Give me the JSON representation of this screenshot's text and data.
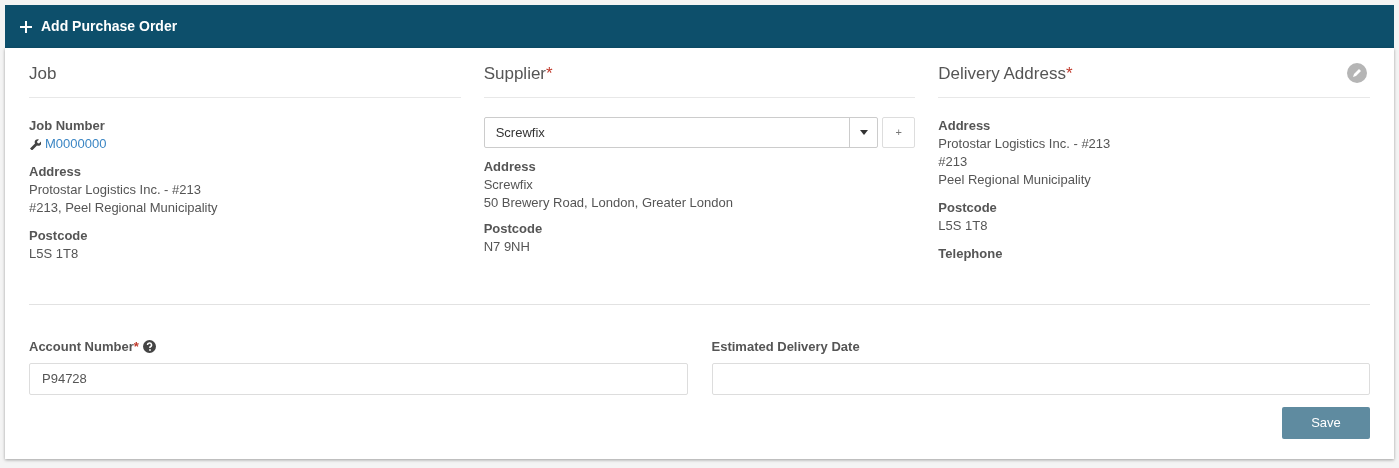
{
  "header": {
    "title": "Add Purchase Order"
  },
  "columns": [
    {
      "kind": "job",
      "heading": "Job",
      "job_number": {
        "label": "Job Number",
        "value": "M0000000"
      },
      "fields": [
        {
          "label": "Address",
          "lines": [
            "Protostar Logistics Inc. - #213",
            "#213, Peel Regional Municipality"
          ]
        },
        {
          "label": "Postcode",
          "lines": [
            "L5S 1T8"
          ]
        }
      ]
    },
    {
      "kind": "supplier",
      "heading": "Supplier",
      "required_mark": "*",
      "select": {
        "value": "Screwfix",
        "add_button": "+"
      },
      "fields": [
        {
          "label": "Address",
          "lines": [
            "Screwfix",
            "50 Brewery Road, London, Greater London"
          ]
        },
        {
          "label": "Postcode",
          "lines": [
            "N7 9NH"
          ]
        }
      ]
    },
    {
      "kind": "delivery",
      "heading": "Delivery Address",
      "required_mark": "*",
      "editable": true,
      "fields": [
        {
          "label": "Address",
          "lines": [
            "Protostar Logistics Inc. - #213",
            "#213",
            "Peel Regional Municipality"
          ]
        },
        {
          "label": "Postcode",
          "lines": [
            "L5S 1T8"
          ]
        },
        {
          "label": "Telephone"
        }
      ]
    }
  ],
  "form_fields": [
    {
      "label": "Account Number",
      "required_mark": "*",
      "help": true,
      "value": "P94728"
    },
    {
      "label": "Estimated Delivery Date",
      "help": false
    }
  ],
  "buttons": [
    "Save"
  ]
}
